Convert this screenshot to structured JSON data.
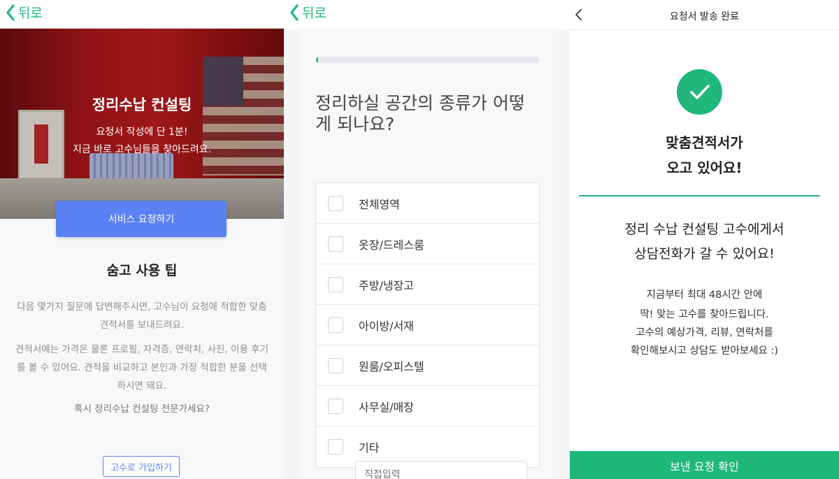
{
  "panel1": {
    "back_label": "뒤로",
    "hero_title": "정리수납 컨설팅",
    "hero_sub1": "요청서 작성에 단 1분!",
    "hero_sub2": "지금 바로 고수님들을 찾아드려요.",
    "request_button": "서비스 요청하기",
    "tips_title": "숨고 사용 팁",
    "tips_para1": "다음 몇가지 질문에 답변해주시면, 고수님이 요청에 적합한 맞춤 견적서를 보내드려요.",
    "tips_para2": "견적서에는 가격은 물론 프로필, 자격증, 연락처, 사진, 이용 후기를 볼 수 있어요. 견적을 비교하고 본인과 가장 적합한 분을 선택하시면 돼요.",
    "tips_para3": "혹시 정리수납 컨설팅 전문가세요?",
    "pro_signup_button": "고수로 가입하기"
  },
  "panel2": {
    "back_label": "뒤로",
    "progress_fraction": 0.01,
    "question": "정리하실 공간의 종류가 어떻게 되나요?",
    "options": [
      {
        "label": "전체영역"
      },
      {
        "label": "옷장/드레스룸"
      },
      {
        "label": "주방/냉장고"
      },
      {
        "label": "아이방/서재"
      },
      {
        "label": "원룸/오피스텔"
      },
      {
        "label": "사무실/매장"
      },
      {
        "label": "기타"
      }
    ],
    "direct_input_placeholder": "직접입력"
  },
  "panel3": {
    "title": "요청서 발송 완료",
    "head1": "맞춤견적서가",
    "head2": "오고 있어요!",
    "sub1": "정리 수납 컨설팅 고수에게서",
    "sub2": "상담전화가 갈 수 있어요!",
    "desc1": "지금부터 최대 48시간 안에",
    "desc2": "딱! 맞는 고수를 찾아드립니다.",
    "desc3": "고수의 예상가격, 리뷰, 연락처를",
    "desc4": "확인해보시고 상담도 받아보세요 :)",
    "confirm_button": "보낸 요청 확인"
  },
  "colors": {
    "accent_green": "#1fb87a",
    "accent_blue": "#5b82f5"
  },
  "icons": {
    "back": "chevron-left-icon",
    "done": "check-icon"
  }
}
